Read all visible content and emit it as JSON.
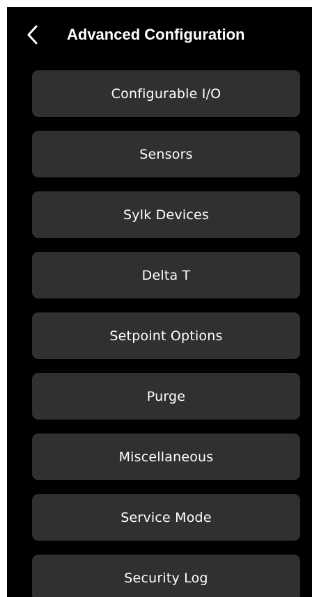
{
  "header": {
    "title": "Advanced Configuration",
    "back_icon": "chevron-left-icon"
  },
  "colors": {
    "background": "#000000",
    "button_fill": "#303030",
    "text": "#ffffff"
  },
  "menu": {
    "items": [
      {
        "label": "Configurable I/O"
      },
      {
        "label": "Sensors"
      },
      {
        "label": "Sylk Devices"
      },
      {
        "label": "Delta T"
      },
      {
        "label": "Setpoint Options"
      },
      {
        "label": "Purge"
      },
      {
        "label": "Miscellaneous"
      },
      {
        "label": "Service Mode"
      },
      {
        "label": "Security Log"
      }
    ]
  }
}
